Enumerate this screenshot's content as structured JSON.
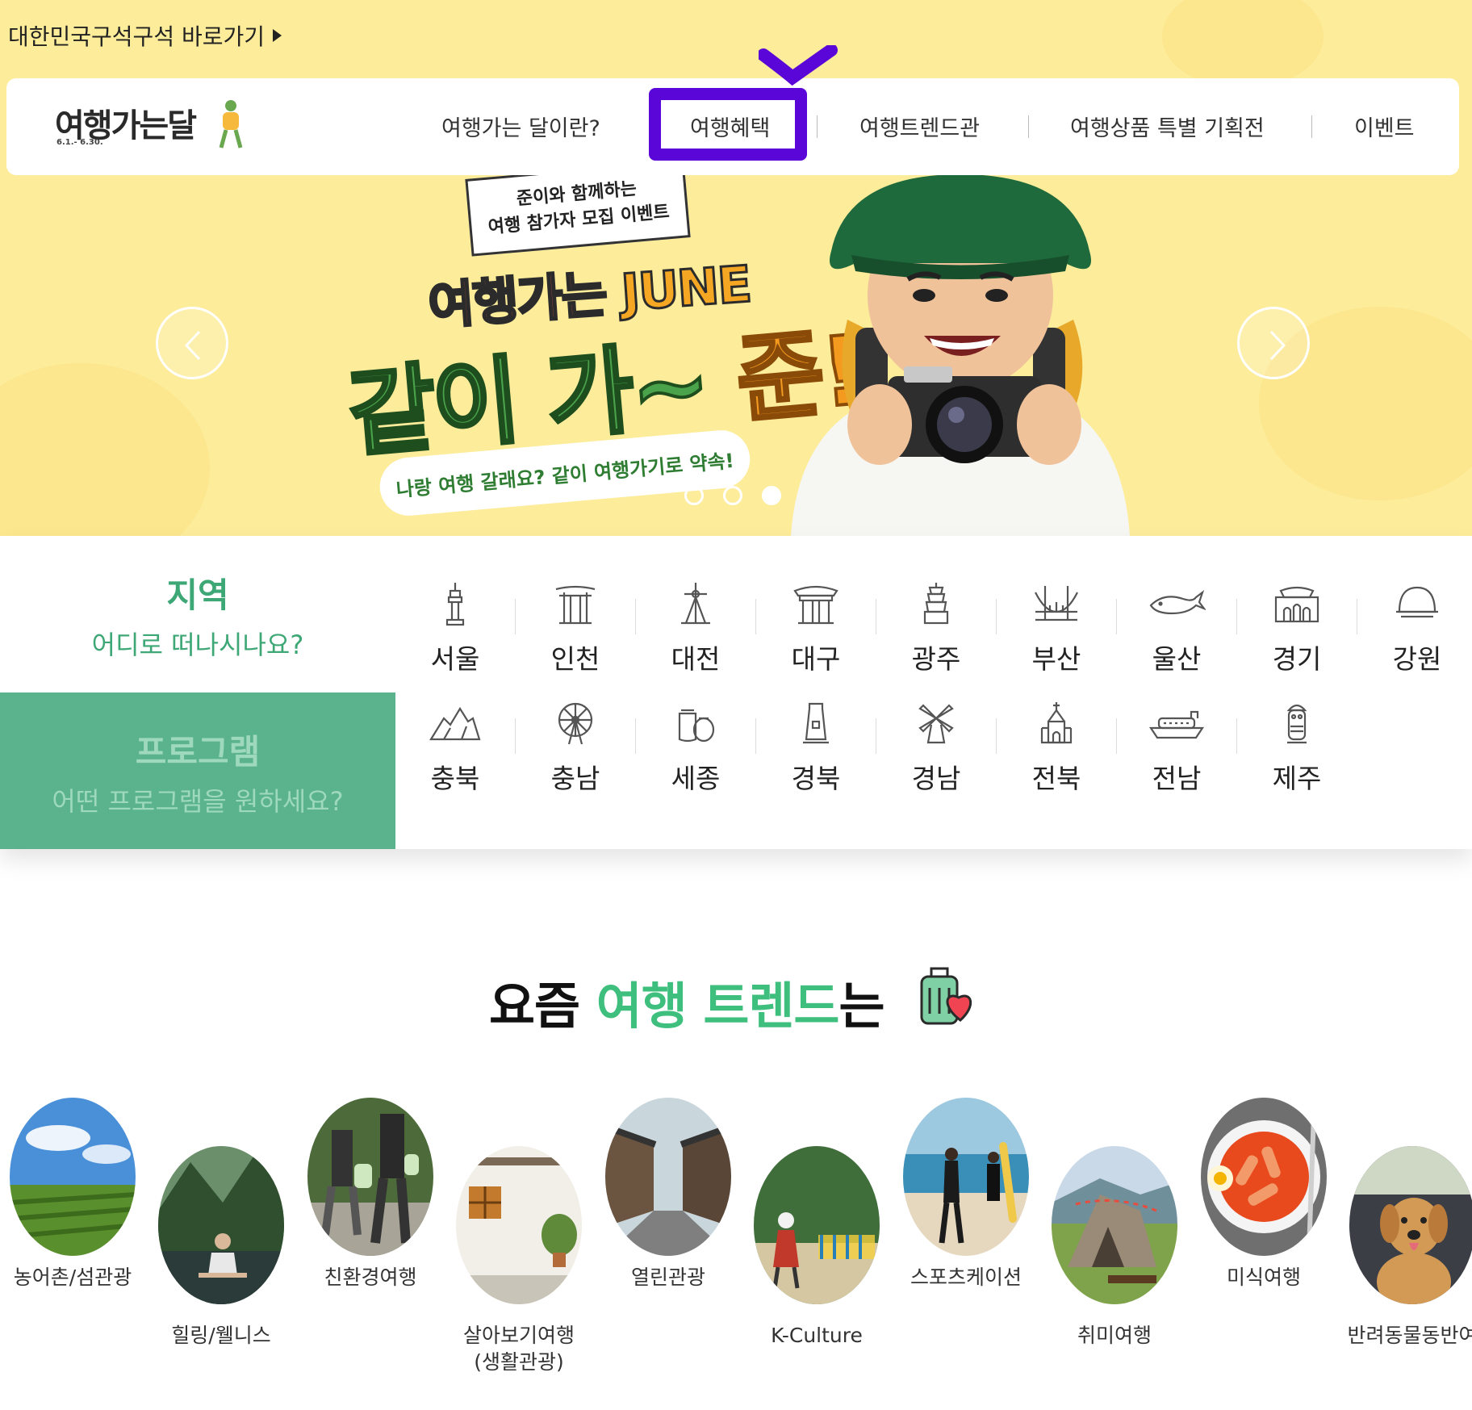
{
  "skip_link": "대한민국구석구석 바로가기",
  "logo": {
    "title": "여행가는달",
    "dates": "6.1.- 6.30."
  },
  "nav": [
    "여행가는 달이란?",
    "여행혜택",
    "여행트렌드관",
    "여행상품 특별 기획전",
    "이벤트"
  ],
  "banner": {
    "sign_line1": "준이와 함께하는",
    "sign_line2": "여행 참가자 모집 이벤트",
    "slogan_top": "여행가는",
    "slogan_june": "JUNE",
    "slogan_main": "같이 가~",
    "slogan_jun": "준!",
    "bubble": "나랑 여행 갈래요? 같이 여행가기로 약속!",
    "slide_count": 3,
    "active_slide": 3
  },
  "tabs": {
    "region": {
      "title": "지역",
      "subtitle": "어디로 떠나시나요?"
    },
    "program": {
      "title": "프로그램",
      "subtitle": "어떤 프로그램을 원하세요?"
    }
  },
  "regions": [
    {
      "label": "서울",
      "icon": "seoul-tower-icon"
    },
    {
      "label": "인천",
      "icon": "gate-icon"
    },
    {
      "label": "대전",
      "icon": "tower-icon"
    },
    {
      "label": "대구",
      "icon": "pavilion-icon"
    },
    {
      "label": "광주",
      "icon": "pagoda-icon"
    },
    {
      "label": "부산",
      "icon": "bridge-icon"
    },
    {
      "label": "울산",
      "icon": "whale-icon"
    },
    {
      "label": "경기",
      "icon": "fortress-icon"
    },
    {
      "label": "강원",
      "icon": "dome-icon"
    },
    {
      "label": "충북",
      "icon": "mountain-icon"
    },
    {
      "label": "충남",
      "icon": "ferris-wheel-icon"
    },
    {
      "label": "세종",
      "icon": "jars-icon"
    },
    {
      "label": "경북",
      "icon": "building-icon"
    },
    {
      "label": "경남",
      "icon": "windmill-icon"
    },
    {
      "label": "전북",
      "icon": "church-icon"
    },
    {
      "label": "전남",
      "icon": "ship-icon"
    },
    {
      "label": "제주",
      "icon": "dolhareubang-icon"
    }
  ],
  "trends": {
    "title_prefix": "요즘",
    "title_highlight": "여행 트렌드",
    "title_suffix": "는",
    "items": [
      {
        "label": "농어촌/섬관광"
      },
      {
        "label": "힐링/웰니스"
      },
      {
        "label": "친환경여행"
      },
      {
        "label": "살아보기여행\n(생활관광)"
      },
      {
        "label": "열린관광"
      },
      {
        "label": "K-Culture"
      },
      {
        "label": "스포츠케이션"
      },
      {
        "label": "취미여행"
      },
      {
        "label": "미식여행"
      },
      {
        "label": "반려동물동반여"
      }
    ]
  },
  "colors": {
    "hero_bg": "#fdec9a",
    "accent_green": "#3ebf7e",
    "program_tab": "#5ab38d",
    "annotation": "#5b06d8"
  }
}
